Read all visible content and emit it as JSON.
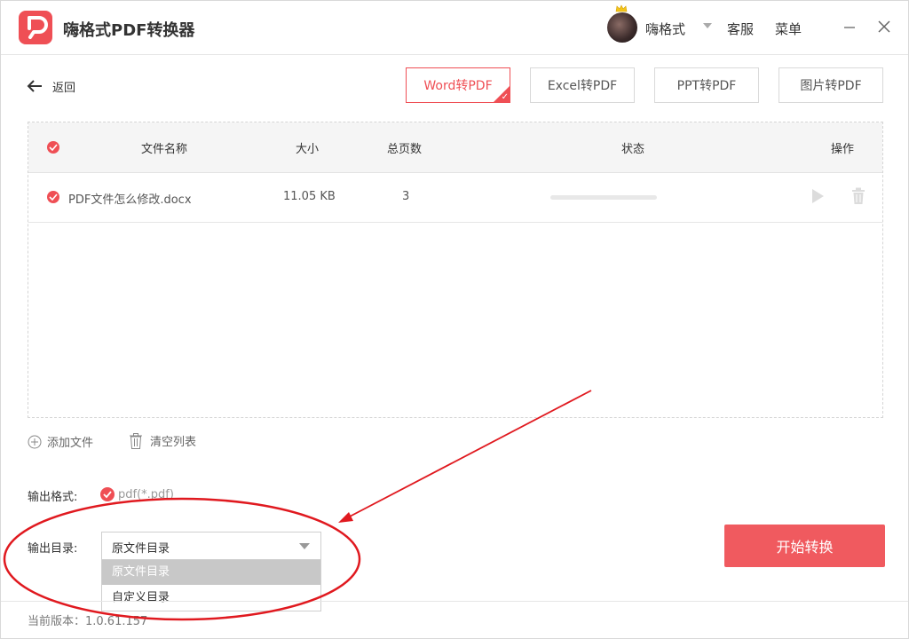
{
  "app": {
    "title": "嗨格式PDF转换器"
  },
  "header": {
    "username": "嗨格式",
    "service": "客服",
    "menu": "菜单"
  },
  "nav": {
    "back_label": "返回"
  },
  "tabs": [
    {
      "label": "Word转PDF",
      "active": true
    },
    {
      "label": "Excel转PDF",
      "active": false
    },
    {
      "label": "PPT转PDF",
      "active": false
    },
    {
      "label": "图片转PDF",
      "active": false
    }
  ],
  "table": {
    "headers": {
      "name": "文件名称",
      "size": "大小",
      "pages": "总页数",
      "status": "状态",
      "ops": "操作"
    },
    "rows": [
      {
        "name": "PDF文件怎么修改.docx",
        "size": "11.05 KB",
        "pages": "3",
        "progress": 0
      }
    ]
  },
  "actions": {
    "add_file": "添加文件",
    "clear_list": "清空列表"
  },
  "output": {
    "format_label": "输出格式:",
    "format_value": "pdf(*.pdf)",
    "dir_label": "输出目录:",
    "dir_value": "原文件目录",
    "dir_options": [
      "原文件目录",
      "自定义目录"
    ]
  },
  "start_button": "开始转换",
  "footer": {
    "version": "当前版本：1.0.61.157"
  },
  "colors": {
    "accent": "#ef4f55",
    "annotation": "#e0191f"
  }
}
